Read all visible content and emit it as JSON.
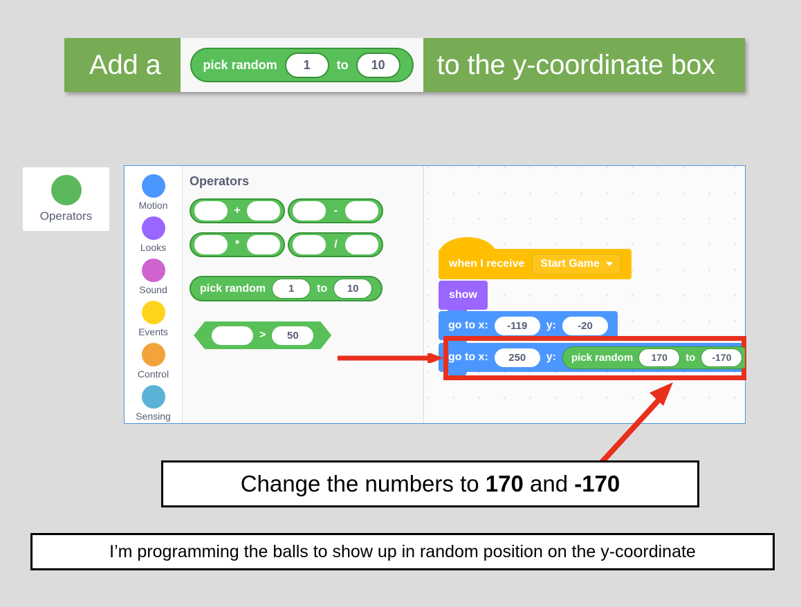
{
  "banner": {
    "text_before": "Add a",
    "text_after": "to the y-coordinate box",
    "block": {
      "label": "pick random",
      "from": "1",
      "to_label": "to",
      "to": "10"
    },
    "color": "#77ab54"
  },
  "category_card": {
    "label": "Operators",
    "dot_color": "#5cb85c"
  },
  "editor": {
    "border_color": "#4d97e0",
    "categories": [
      {
        "label": "Motion",
        "color": "#4c97ff"
      },
      {
        "label": "Looks",
        "color": "#9966ff"
      },
      {
        "label": "Sound",
        "color": "#cf63cf"
      },
      {
        "label": "Events",
        "color": "#ffd31c"
      },
      {
        "label": "Control",
        "color": "#f2a33c"
      },
      {
        "label": "Sensing",
        "color": "#5cb1d6"
      }
    ],
    "palette": {
      "title": "Operators",
      "operator_blocks": [
        {
          "symbol": "+",
          "left": "",
          "right": ""
        },
        {
          "symbol": "-",
          "left": "",
          "right": ""
        },
        {
          "symbol": "*",
          "left": "",
          "right": ""
        },
        {
          "symbol": "/",
          "left": "",
          "right": ""
        }
      ],
      "pick_random": {
        "label": "pick random",
        "from": "1",
        "to_label": "to",
        "to": "10"
      },
      "greater_than": {
        "left": "",
        "symbol": ">",
        "right": "50"
      },
      "block_color": "#59c059"
    },
    "workspace": {
      "hat_block": {
        "label": "when I receive",
        "dropdown_value": "Start Game",
        "color": "#ffbf00"
      },
      "show_block": {
        "label": "show",
        "color": "#9966ff"
      },
      "goto_block_1": {
        "x_label": "go to x:",
        "x_value": "-119",
        "y_label": "y:",
        "y_value": "-20",
        "color": "#4c97ff"
      },
      "goto_block_2": {
        "x_label": "go to x:",
        "x_value": "250",
        "y_label": "y:",
        "pick_random": {
          "label": "pick random",
          "from": "170",
          "to_label": "to",
          "to": "-170"
        },
        "color": "#4c97ff"
      }
    }
  },
  "annotations": {
    "highlight_color": "#e8301c",
    "change_instruction_prefix": "Change the numbers to ",
    "change_instruction_value_1": "170",
    "change_instruction_middle": " and ",
    "change_instruction_value_2": "-170",
    "caption": "I’m programming the balls to show up in random position on the y-coordinate"
  }
}
